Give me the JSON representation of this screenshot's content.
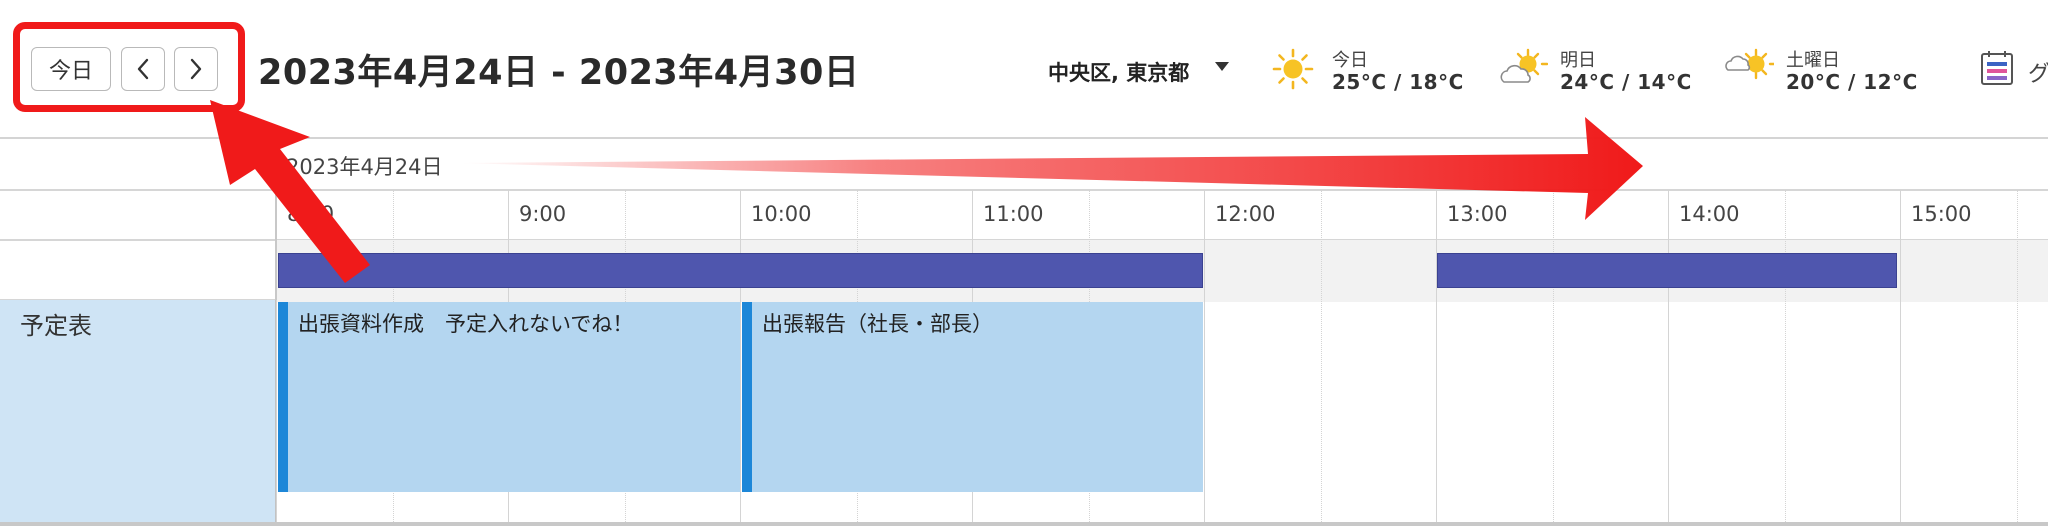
{
  "toolbar": {
    "today_label": "今日",
    "prev_glyph": "<",
    "next_glyph": ">",
    "range_title": "2023年4月24日 - 2023年4月30日"
  },
  "location": {
    "label": "中央区, 東京都"
  },
  "weather": [
    {
      "day": "今日",
      "temp": "25°C / 18°C",
      "icon": "sun-icon"
    },
    {
      "day": "明日",
      "temp": "24°C / 14°C",
      "icon": "cloud-sun-icon"
    },
    {
      "day": "土曜日",
      "temp": "20°C / 12°C",
      "icon": "cloud-sun-icon"
    }
  ],
  "group_view": {
    "label": "グ",
    "icon": "calendar-group-icon"
  },
  "timeline": {
    "date_label": "2023年4月24日",
    "hours": [
      "8:00",
      "9:00",
      "10:00",
      "11:00",
      "12:00",
      "13:00",
      "14:00",
      "15:00"
    ]
  },
  "rows": {
    "schedule_label": "予定表"
  },
  "events": [
    {
      "title": "出張資料作成　予定入れないでね！",
      "start": "8:00",
      "end": "12:00"
    },
    {
      "title": "出張報告（社長・部長）",
      "start": "10:00",
      "end": "12:00"
    }
  ],
  "allday_bars": [
    {
      "start": "8:00",
      "end": "12:00",
      "status": "busy"
    },
    {
      "start": "13:00",
      "end": "15:00",
      "status": "busy"
    }
  ],
  "colors": {
    "accent_red": "#f01a1a",
    "busy_bar": "#4f56ae",
    "event_fill": "#b4d6f0",
    "event_accent": "#1d87d8",
    "row_label_bg": "#cfe4f5"
  }
}
